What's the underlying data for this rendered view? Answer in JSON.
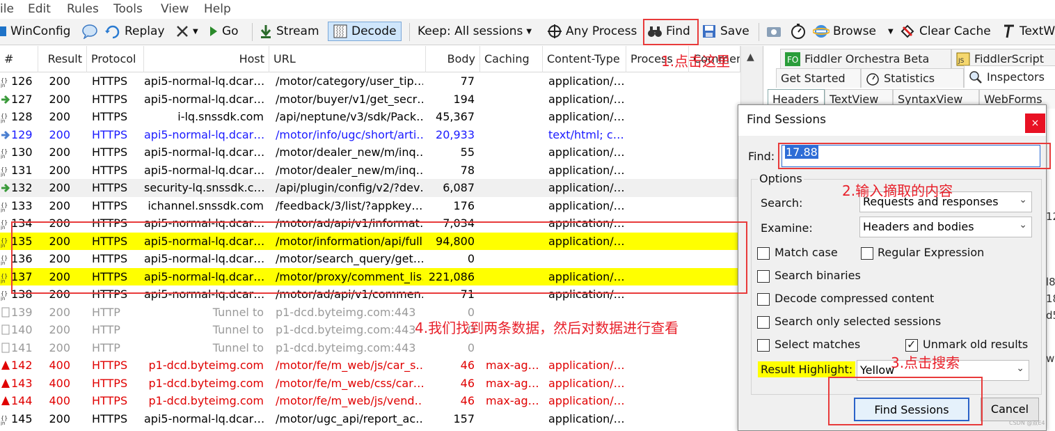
{
  "menu": [
    "ile",
    "Edit",
    "Rules",
    "Tools",
    "View",
    "Help"
  ],
  "toolbar": {
    "winconfig": "WinConfig",
    "replay": "Replay",
    "go": "Go",
    "stream": "Stream",
    "decode": "Decode",
    "keep": "Keep: All sessions",
    "any_process": "Any Process",
    "find": "Find",
    "save": "Save",
    "browse": "Browse",
    "clear_cache": "Clear Cache",
    "textwizard": "TextW"
  },
  "grid": {
    "columns": [
      "Result",
      "Protocol",
      "Host",
      "URL",
      "Body",
      "Caching",
      "Content-Type",
      "Process",
      "Commen"
    ],
    "rows": [
      {
        "id": "126",
        "result": "200",
        "protocol": "HTTPS",
        "host": "api5-normal-lq.dcar…",
        "url": "/motor/category/user_tip…",
        "body": "77",
        "caching": "",
        "ctype": "application/…",
        "style": ""
      },
      {
        "id": "127",
        "result": "200",
        "protocol": "HTTPS",
        "host": "api5-normal-lq.dcar…",
        "url": "/motor/buyer/v1/get_secr…",
        "body": "194",
        "caching": "",
        "ctype": "application/…",
        "style": ""
      },
      {
        "id": "128",
        "result": "200",
        "protocol": "HTTPS",
        "host": "i-lq.snssdk.com",
        "url": "/api/neptune/v3/sdk/Pack…",
        "body": "45,367",
        "caching": "",
        "ctype": "application/…",
        "style": ""
      },
      {
        "id": "129",
        "result": "200",
        "protocol": "HTTPS",
        "host": "api5-normal-lq.dcar…",
        "url": "/motor/info/ugc/short/arti…",
        "body": "20,933",
        "caching": "",
        "ctype": "text/html; c…",
        "style": "blue"
      },
      {
        "id": "130",
        "result": "200",
        "protocol": "HTTPS",
        "host": "api5-normal-lq.dcar…",
        "url": "/motor/dealer_new/m/inq…",
        "body": "55",
        "caching": "",
        "ctype": "application/…",
        "style": ""
      },
      {
        "id": "131",
        "result": "200",
        "protocol": "HTTPS",
        "host": "api5-normal-lq.dcar…",
        "url": "/motor/dealer_new/m/inq…",
        "body": "78",
        "caching": "",
        "ctype": "application/…",
        "style": ""
      },
      {
        "id": "132",
        "result": "200",
        "protocol": "HTTPS",
        "host": "security-lq.snssdk.c…",
        "url": "/api/plugin/config/v2/?dev…",
        "body": "6,087",
        "caching": "",
        "ctype": "application/…",
        "style": "sel"
      },
      {
        "id": "133",
        "result": "200",
        "protocol": "HTTPS",
        "host": "ichannel.snssdk.com",
        "url": "/feedback/3/list/?appkey…",
        "body": "176",
        "caching": "",
        "ctype": "application/…",
        "style": ""
      },
      {
        "id": "134",
        "result": "200",
        "protocol": "HTTPS",
        "host": "api5-normal-lq.dcar…",
        "url": "/motor/ad/api/v1/informat…",
        "body": "7,034",
        "caching": "",
        "ctype": "application/…",
        "style": ""
      },
      {
        "id": "135",
        "result": "200",
        "protocol": "HTTPS",
        "host": "api5-normal-lq.dcar…",
        "url": "/motor/information/api/full…",
        "body": "94,800",
        "caching": "",
        "ctype": "application/…",
        "style": "yellow"
      },
      {
        "id": "136",
        "result": "200",
        "protocol": "HTTPS",
        "host": "api5-normal-lq.dcar…",
        "url": "/motor/search_query/get…",
        "body": "0",
        "caching": "",
        "ctype": "",
        "style": ""
      },
      {
        "id": "137",
        "result": "200",
        "protocol": "HTTPS",
        "host": "api5-normal-lq.dcar…",
        "url": "/motor/proxy/comment_lis…",
        "body": "221,086",
        "caching": "",
        "ctype": "application/…",
        "style": "yellow"
      },
      {
        "id": "138",
        "result": "200",
        "protocol": "HTTPS",
        "host": "api5-normal-lq.dcar…",
        "url": "/motor/ad/api/v1/commen…",
        "body": "71",
        "caching": "",
        "ctype": "application/…",
        "style": ""
      },
      {
        "id": "139",
        "result": "200",
        "protocol": "HTTP",
        "host": "Tunnel to",
        "url": "p1-dcd.byteimg.com:443",
        "body": "0",
        "caching": "",
        "ctype": "",
        "style": "grey"
      },
      {
        "id": "140",
        "result": "200",
        "protocol": "HTTP",
        "host": "Tunnel to",
        "url": "p1-dcd.byteimg.com:443",
        "body": "0",
        "caching": "",
        "ctype": "",
        "style": "grey"
      },
      {
        "id": "141",
        "result": "200",
        "protocol": "HTTP",
        "host": "Tunnel to",
        "url": "p1-dcd.byteimg.com:443",
        "body": "0",
        "caching": "",
        "ctype": "",
        "style": "grey"
      },
      {
        "id": "142",
        "result": "400",
        "protocol": "HTTPS",
        "host": "p1-dcd.byteimg.com",
        "url": "/motor/fe/m_web/js/car_s…",
        "body": "46",
        "caching": "max-ag…",
        "ctype": "application/…",
        "style": "red"
      },
      {
        "id": "143",
        "result": "400",
        "protocol": "HTTPS",
        "host": "p1-dcd.byteimg.com",
        "url": "/motor/fe/m_web/css/car…",
        "body": "46",
        "caching": "max-ag…",
        "ctype": "application/…",
        "style": "red"
      },
      {
        "id": "144",
        "result": "400",
        "protocol": "HTTPS",
        "host": "p1-dcd.byteimg.com",
        "url": "/motor/fe/m_web/js/vend…",
        "body": "46",
        "caching": "max-ag…",
        "ctype": "application/…",
        "style": "red"
      },
      {
        "id": "145",
        "result": "200",
        "protocol": "HTTPS",
        "host": "api5-normal-lq.dcar…",
        "url": "/motor/ugc_api/report_ac…",
        "body": "157",
        "caching": "",
        "ctype": "application/…",
        "style": ""
      }
    ]
  },
  "right_panel": {
    "tabs_row1": [
      "Fiddler Orchestra Beta",
      "FiddlerScript"
    ],
    "tabs_row2": [
      "Get Started",
      "Statistics",
      "Inspectors"
    ],
    "tabs_row3": [
      "Headers",
      "TextView",
      "SyntaxView",
      "WebForms"
    ],
    "side_fragments": [
      "12",
      "l8",
      "18",
      "d5",
      "w"
    ]
  },
  "dialog": {
    "title": "Find Sessions",
    "close": "×",
    "find_label": "Find:",
    "find_value": "17.88",
    "options_label": "Options",
    "search_label": "Search:",
    "search_value": "Requests and responses",
    "examine_label": "Examine:",
    "examine_value": "Headers and bodies",
    "match_case": "Match case",
    "regex": "Regular Expression",
    "search_binaries": "Search binaries",
    "decode_compressed": "Decode compressed content",
    "search_selected": "Search only selected sessions",
    "select_matches": "Select matches",
    "unmark_old": "Unmark old results",
    "unmark_checked": true,
    "result_highlight_label": "Result Highlight:",
    "result_highlight_value": "Yellow",
    "find_button": "Find Sessions",
    "cancel_button": "Cancel"
  },
  "annotations": {
    "a1": "1.点击这里",
    "a2": "2.输入摘取的内容",
    "a3": "3.点击搜索",
    "a4": "4.我们找到两条数据，然后对数据进行查看"
  },
  "watermark": "CSDN @双E4",
  "colors": {
    "highlight_yellow": "#ffff00",
    "annotation_red": "#e8202a",
    "link_blue": "#1a1aff",
    "error_red": "#e00000",
    "tunnel_grey": "#9a9a9a"
  }
}
